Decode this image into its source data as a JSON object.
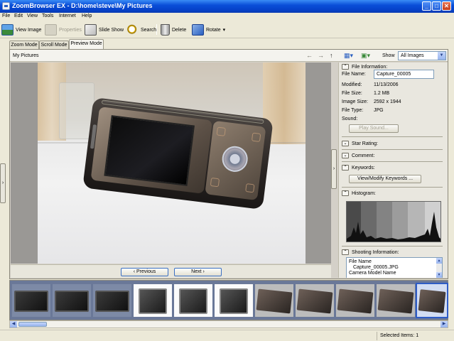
{
  "window": {
    "title": "ZoomBrowser EX  - D:\\home\\steve\\My Pictures",
    "min_glyph": "_",
    "max_glyph": "□",
    "close_glyph": "✕"
  },
  "menu": [
    "File",
    "Edit",
    "View",
    "Tools",
    "Internet",
    "Help"
  ],
  "toolbar": {
    "view_image": "View Image",
    "properties": "Properties",
    "slide_show": "Slide Show",
    "search": "Search",
    "delete": "Delete",
    "rotate": "Rotate"
  },
  "tabs": [
    "Zoom Mode",
    "Scroll Mode",
    "Preview Mode"
  ],
  "active_tab": "Preview Mode",
  "location": "My Pictures",
  "show": {
    "label": "Show",
    "value": "All Images"
  },
  "nav": {
    "previous": "Previous",
    "next": "Next"
  },
  "info": {
    "file_information": "File Information:",
    "file_name_label": "File Name:",
    "file_name": "Capture_00005",
    "rows": [
      {
        "k": "Modified:",
        "v": "11/13/2006"
      },
      {
        "k": "File Size:",
        "v": "1.2 MB"
      },
      {
        "k": "Image Size:",
        "v": "2592 x 1944"
      },
      {
        "k": "File Type:",
        "v": "JPG"
      },
      {
        "k": "Sound:",
        "v": ""
      }
    ],
    "play_sound": "Play Sound...",
    "star_rating": "Star Rating:",
    "comment": "Comment:",
    "keywords": "Keywords:",
    "view_modify_keywords": "View/Modify Keywords ...",
    "histogram": "Histogram:",
    "shooting_information": "Shooting Information:",
    "shooting_lines": [
      "File Name",
      "  Capture_00005.JPG",
      "Camera Model Name"
    ]
  },
  "status": {
    "selected": "Selected Items: 1"
  },
  "colors": {
    "titlebar": "#0a4fd8",
    "selection": "#2e5cc5",
    "button_border": "#3a6fc3"
  }
}
